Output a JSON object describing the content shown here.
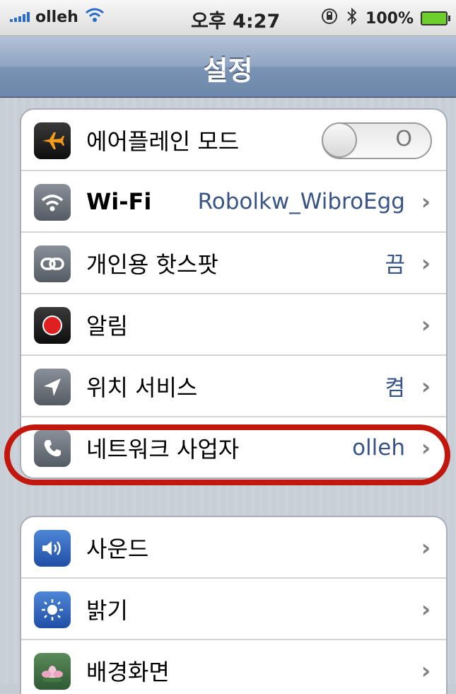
{
  "status_bar": {
    "carrier": "olleh",
    "time": "오후 4:27",
    "battery": "100%"
  },
  "navbar": {
    "title": "설정"
  },
  "group1": [
    {
      "label": "에어플레인 모드",
      "value": "",
      "toggle": "O",
      "icon": "airplane-icon"
    },
    {
      "label": "Wi-Fi",
      "value": "Robolkw_WibroEgg",
      "icon": "wifi-icon"
    },
    {
      "label": "개인용 핫스팟",
      "value": "끔",
      "icon": "hotspot-icon"
    },
    {
      "label": "알림",
      "value": "",
      "icon": "notification-icon"
    },
    {
      "label": "위치 서비스",
      "value": "켬",
      "icon": "location-icon"
    },
    {
      "label": "네트워크 사업자",
      "value": "olleh",
      "icon": "phone-icon"
    }
  ],
  "group2": [
    {
      "label": "사운드",
      "icon": "sound-icon"
    },
    {
      "label": "밝기",
      "icon": "brightness-icon"
    },
    {
      "label": "배경화면",
      "icon": "wallpaper-icon"
    }
  ],
  "colors": {
    "highlight": "#c2170c",
    "value_text": "#385487"
  }
}
